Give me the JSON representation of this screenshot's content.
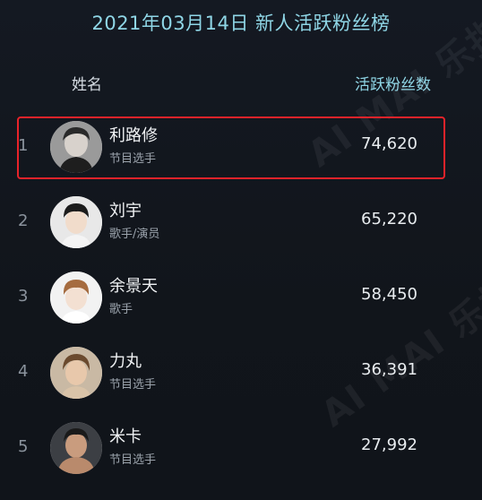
{
  "title": "2021年03月14日 新人活跃粉丝榜",
  "header": {
    "name_label": "姓名",
    "fans_label": "活跃粉丝数"
  },
  "watermark": "AI MAI 乐指数",
  "rows": [
    {
      "rank": "1",
      "name": "利路修",
      "role": "节目选手",
      "fans": "74,620",
      "highlighted": true
    },
    {
      "rank": "2",
      "name": "刘宇",
      "role": "歌手/演员",
      "fans": "65,220",
      "highlighted": false
    },
    {
      "rank": "3",
      "name": "余景天",
      "role": "歌手",
      "fans": "58,450",
      "highlighted": false
    },
    {
      "rank": "4",
      "name": "力丸",
      "role": "节目选手",
      "fans": "36,391",
      "highlighted": false
    },
    {
      "rank": "5",
      "name": "米卡",
      "role": "节目选手",
      "fans": "27,992",
      "highlighted": false
    }
  ],
  "colors": {
    "accent": "#8fd6e6",
    "highlight_border": "#e8232a",
    "background": "#12161d"
  }
}
